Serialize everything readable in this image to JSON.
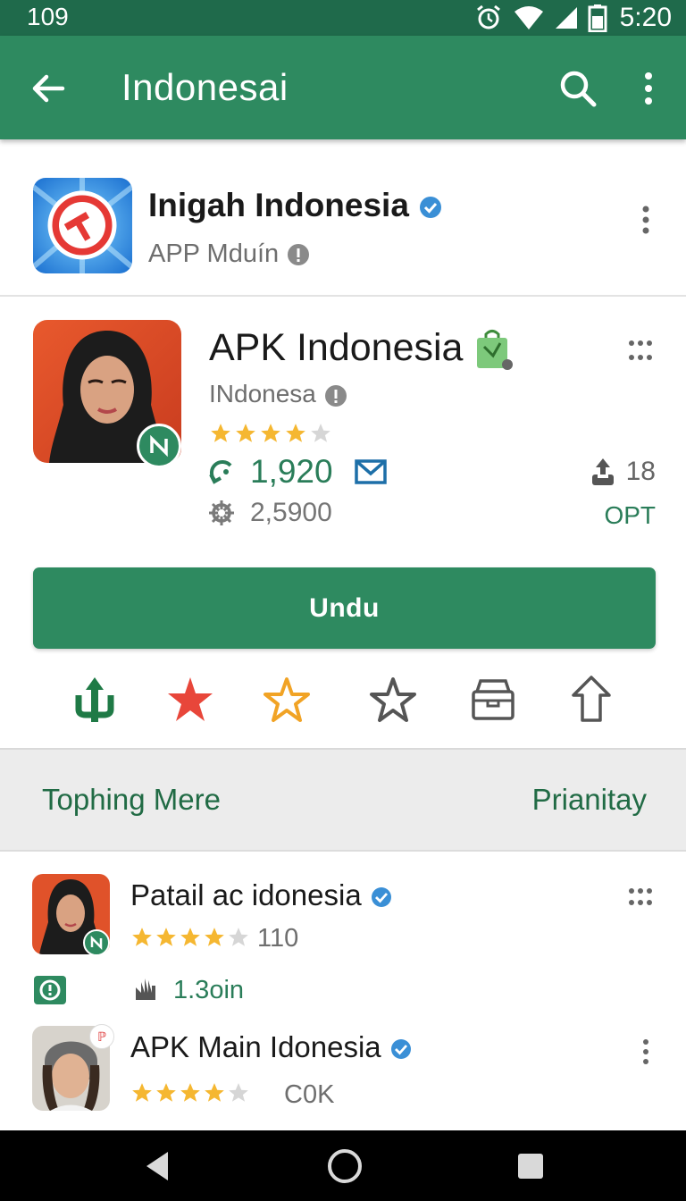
{
  "status_bar": {
    "left_text": "109",
    "time": "5:20"
  },
  "app_bar": {
    "title": "Indonesai",
    "icons": [
      "back-arrow-icon",
      "search-icon",
      "more-vert-icon"
    ]
  },
  "card1": {
    "name": "Inigah Indonesia",
    "subtitle": "APP Mduín"
  },
  "card2": {
    "name": "APK Indonesia",
    "subtitle": "INdonesa",
    "rating": 4,
    "count": "1,920",
    "size": "2,5900",
    "right_count": "18",
    "right_label": "OPT",
    "install_label": "Undu"
  },
  "action_icons": [
    "cactus-icon",
    "star-filled-icon",
    "star-outline-yellow-icon",
    "star-outline-icon",
    "archive-box-icon",
    "share-upload-icon"
  ],
  "section": {
    "left": "Tophing Mere",
    "right": "Prianitay"
  },
  "list": [
    {
      "name": "Patail ac idonesia",
      "rating": 4,
      "count": "110",
      "downloads": "1.3oin"
    },
    {
      "name": "APK Main Idonesia",
      "rating": 4,
      "count": "C0K"
    }
  ],
  "colors": {
    "primary": "#2e8a60",
    "status": "#1f6a4b",
    "star": "#f5b731",
    "accent_text": "#2a7d59"
  }
}
